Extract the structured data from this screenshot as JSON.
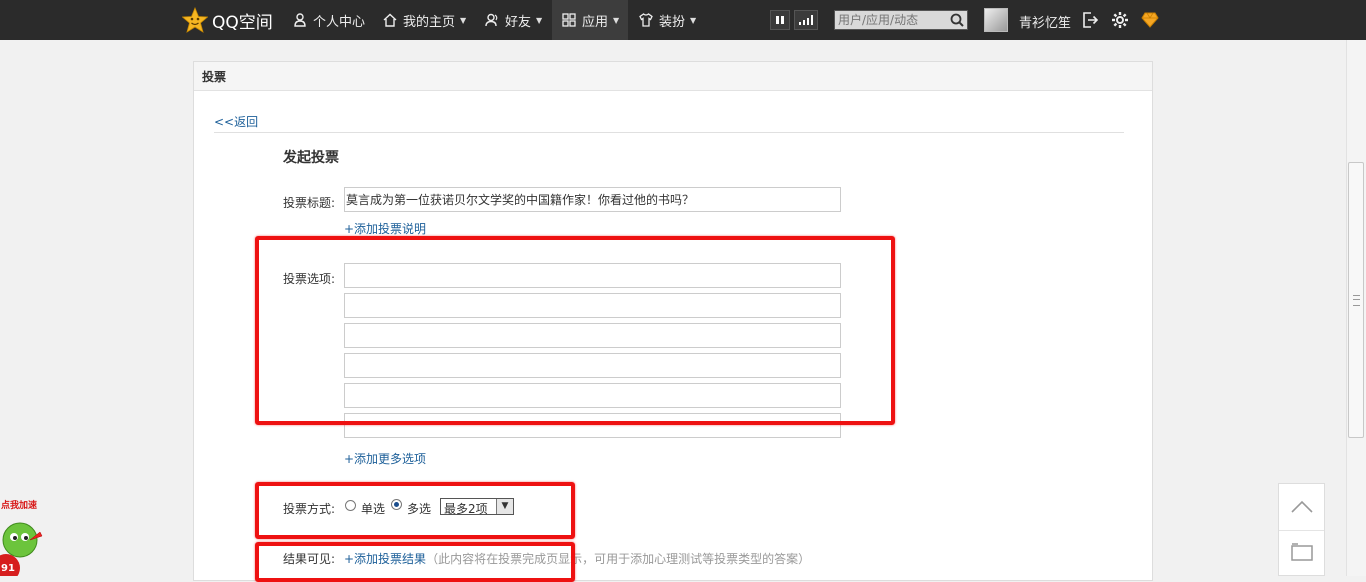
{
  "topbar": {
    "logo": "QQ空间",
    "nav": [
      {
        "label": "个人中心",
        "icon": "user-icon"
      },
      {
        "label": "我的主页",
        "icon": "home-icon"
      },
      {
        "label": "好友",
        "icon": "friends-icon"
      },
      {
        "label": "应用",
        "icon": "apps-grid-icon"
      },
      {
        "label": "装扮",
        "icon": "shirt-icon"
      }
    ],
    "search_placeholder": "用户/应用/动态",
    "username": "青衫忆笙"
  },
  "panel": {
    "header": "投票",
    "back_link": "<<返回",
    "heading": "发起投票",
    "title_label": "投票标题:",
    "title_value": "莫言成为第一位获诺贝尔文学奖的中国籍作家！你看过他的书吗？",
    "add_desc_link": "+添加投票说明",
    "options_label": "投票选项:",
    "options": [
      "",
      "",
      "",
      "",
      "",
      ""
    ],
    "add_more_link": "+添加更多选项",
    "mode_label": "投票方式:",
    "mode_single": "单选",
    "mode_multi": "多选",
    "mode_selected": "多选",
    "max_select": "最多2项",
    "result_label": "结果可见:",
    "add_result_link": "+添加投票结果",
    "result_hint": "（此内容将在投票完成页显示，可用于添加心理测试等投票类型的答案）"
  },
  "speedup": {
    "label": "点我加速",
    "badge": "91"
  },
  "colors": {
    "topbar_bg": "#2b2b2b",
    "link": "#1c5f99",
    "annotation": "#ee1111",
    "accent": "#f5a623"
  }
}
